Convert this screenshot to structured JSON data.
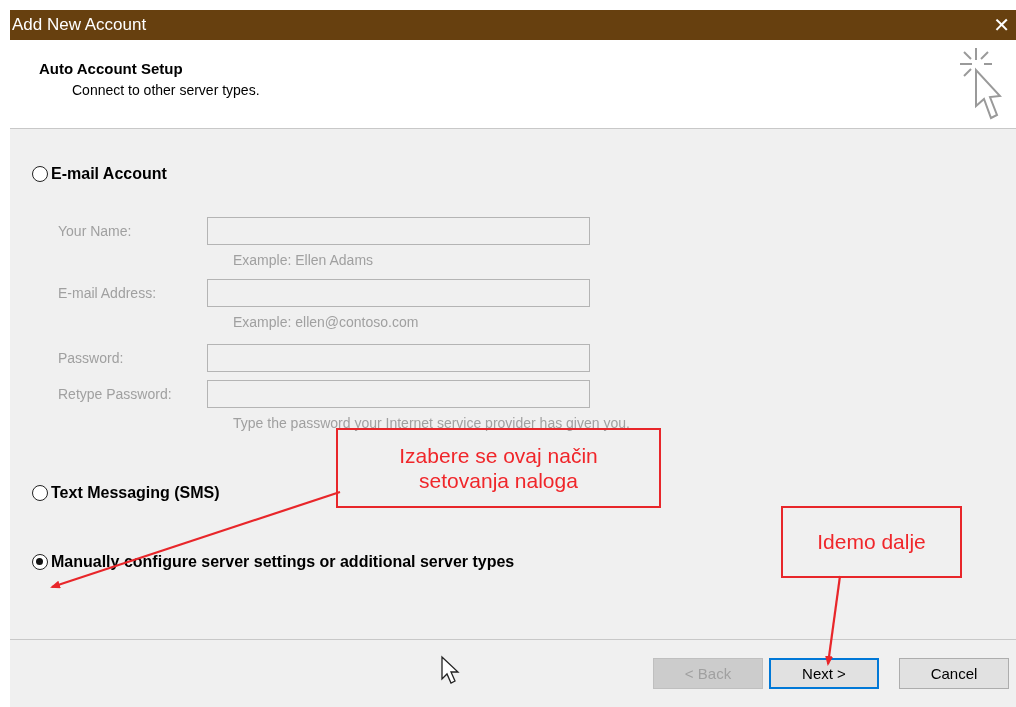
{
  "window": {
    "title": "Add New Account",
    "close": "✕"
  },
  "header": {
    "title": "Auto Account Setup",
    "subtitle": "Connect to other server types."
  },
  "options": [
    {
      "kind": "radio",
      "label": "E-mail Account",
      "selected": false,
      "fields": [
        {
          "label": "Your Name:",
          "disabled": true,
          "hint": "Example: Ellen Adams"
        },
        {
          "label": "E-mail Address:",
          "disabled": true,
          "hint": "Example: ellen@contoso.com"
        },
        {
          "label": "Password:",
          "disabled": true
        },
        {
          "label": "Retype Password:",
          "disabled": true,
          "hint": "Type the password your Internet service provider has given you."
        }
      ]
    },
    {
      "kind": "radio",
      "label": "Text Messaging (SMS)",
      "selected": false
    },
    {
      "kind": "radio",
      "label": "Manually configure server settings or additional server types",
      "selected": true
    }
  ],
  "buttons": [
    {
      "label": "< Back",
      "disabled": true,
      "default": false
    },
    {
      "label": "Next >",
      "disabled": false,
      "default": true
    },
    {
      "label": "Cancel",
      "disabled": false,
      "default": false
    }
  ],
  "annotations": [
    {
      "lines": [
        "Izabere se ovaj način",
        "setovanja naloga"
      ]
    },
    {
      "lines": [
        "Idemo dalje"
      ]
    }
  ]
}
